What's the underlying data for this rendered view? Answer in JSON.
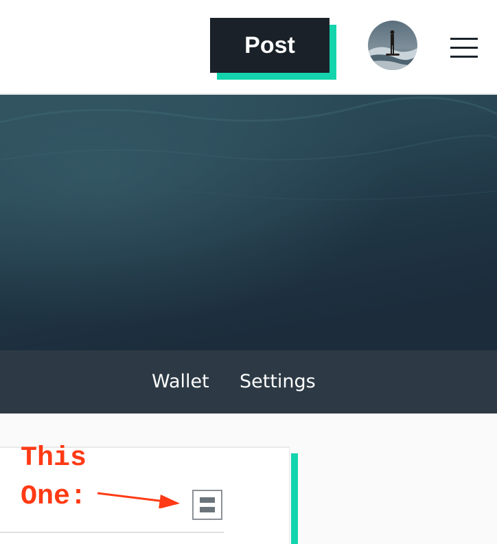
{
  "header": {
    "post_label": "Post",
    "icons": {
      "avatar": "user-avatar-photo",
      "menu": "hamburger-menu-icon"
    }
  },
  "subnav": {
    "items": [
      {
        "label": "Wallet"
      },
      {
        "label": "Settings"
      }
    ]
  },
  "content": {
    "annotation": {
      "line1": "This",
      "line2": "One:",
      "icon": "arrow-icon"
    },
    "target_icon": "collapse-toggle-icon"
  },
  "colors": {
    "accent": "#13d4ac",
    "dark_button": "#1a2129",
    "subnav_bg": "#2d3a45",
    "annotation": "#ff3a14"
  }
}
